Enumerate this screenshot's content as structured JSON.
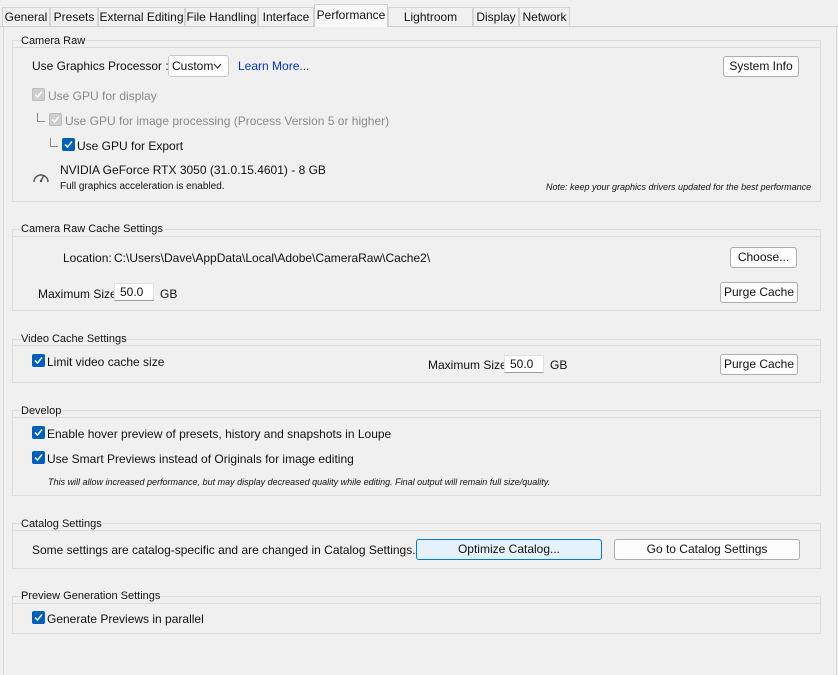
{
  "tabs": [
    {
      "label": "General"
    },
    {
      "label": "Presets"
    },
    {
      "label": "External Editing"
    },
    {
      "label": "File Handling"
    },
    {
      "label": "Interface"
    },
    {
      "label": "Performance"
    },
    {
      "label": "Lightroom Sync"
    },
    {
      "label": "Display"
    },
    {
      "label": "Network"
    }
  ],
  "active_tab": "Performance",
  "camera_raw": {
    "title": "Camera Raw",
    "gpu_label": "Use Graphics Processor :",
    "gpu_value": "Custom",
    "learn_more": "Learn More...",
    "system_info_button": "System Info",
    "gpu_display": {
      "label": "Use GPU for display",
      "checked": true,
      "enabled": false
    },
    "gpu_processing": {
      "label": "Use GPU for image processing (Process Version 5 or higher)",
      "checked": true,
      "enabled": false
    },
    "gpu_export": {
      "label": "Use GPU for Export",
      "checked": true,
      "enabled": true
    },
    "gpu_name": "NVIDIA GeForce RTX 3050 (31.0.15.4601) - 8 GB",
    "gpu_status": "Full graphics acceleration is enabled.",
    "driver_note": "Note: keep your graphics drivers updated for the best performance"
  },
  "cache": {
    "title": "Camera Raw Cache Settings",
    "location_label": "Location:",
    "location_value": "C:\\Users\\Dave\\AppData\\Local\\Adobe\\CameraRaw\\Cache2\\",
    "choose_button": "Choose...",
    "max_size_label": "Maximum Size:",
    "max_size_value": "50.0",
    "unit": "GB",
    "purge_button": "Purge Cache"
  },
  "video_cache": {
    "title": "Video Cache Settings",
    "limit": {
      "label": "Limit video cache size",
      "checked": true
    },
    "max_size_label": "Maximum Size:",
    "max_size_value": "50.0",
    "unit": "GB",
    "purge_button": "Purge Cache"
  },
  "develop": {
    "title": "Develop",
    "hover_preview": {
      "label": "Enable hover preview of presets, history and snapshots in Loupe",
      "checked": true
    },
    "smart_previews": {
      "label": "Use Smart Previews instead of Originals for image editing",
      "checked": true
    },
    "note": "This will allow increased performance, but may display decreased quality while editing. Final output will remain full size/quality."
  },
  "catalog": {
    "title": "Catalog Settings",
    "text": "Some settings are catalog-specific and are changed in Catalog Settings.",
    "optimize_button": "Optimize Catalog...",
    "goto_button": "Go to Catalog Settings"
  },
  "preview": {
    "title": "Preview Generation Settings",
    "parallel": {
      "label": "Generate Previews in parallel",
      "checked": true
    }
  }
}
